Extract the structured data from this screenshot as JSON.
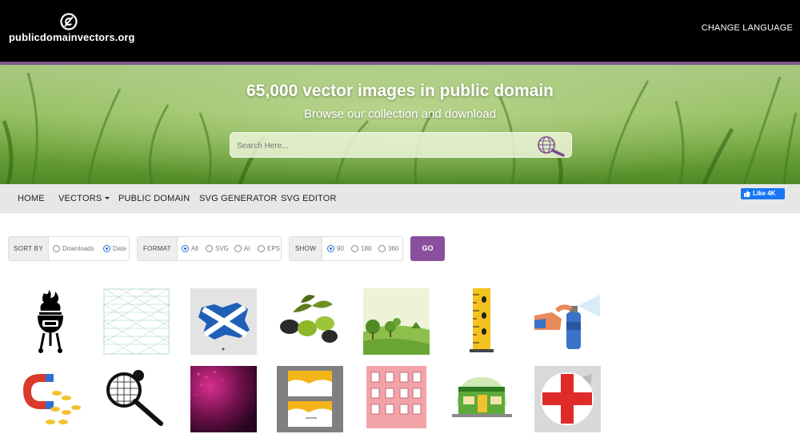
{
  "header": {
    "logo_text": "publicdomainvectors.org",
    "change_language": "CHANGE LANGUAGE"
  },
  "hero": {
    "title": "65,000 vector images in public domain",
    "subtitle": "Browse our collection and download",
    "search_placeholder": "Search Here..."
  },
  "nav": {
    "items": [
      "HOME",
      "VECTORS",
      "PUBLIC DOMAIN",
      "SVG GENERATOR",
      "SVG EDITOR"
    ],
    "like_label": "Like 4K"
  },
  "filters": {
    "sort_by": {
      "label": "SORT BY",
      "options": [
        "Downloads",
        "Date"
      ],
      "selected": "Date"
    },
    "format": {
      "label": "FORMAT",
      "options": [
        "All",
        "SVG",
        "AI",
        "EPS"
      ],
      "selected": "All"
    },
    "show": {
      "label": "SHOW",
      "options": [
        "90",
        "180",
        "360"
      ],
      "selected": "90"
    },
    "go_label": "GO"
  },
  "gallery": {
    "items": [
      "barbecue-grill",
      "isometric-grid",
      "scottish-flag",
      "olives",
      "green-landscape",
      "measuring-tape",
      "spray-can",
      "horseshoe-magnet",
      "tennis-racket",
      "pink-abstract",
      "business-card",
      "pink-building",
      "green-store",
      "red-cross-sticker"
    ]
  },
  "colors": {
    "accent_purple": "#8a4f9c",
    "header_bg": "#000000",
    "nav_bg": "#e7e7e7",
    "facebook_blue": "#1877f2"
  }
}
